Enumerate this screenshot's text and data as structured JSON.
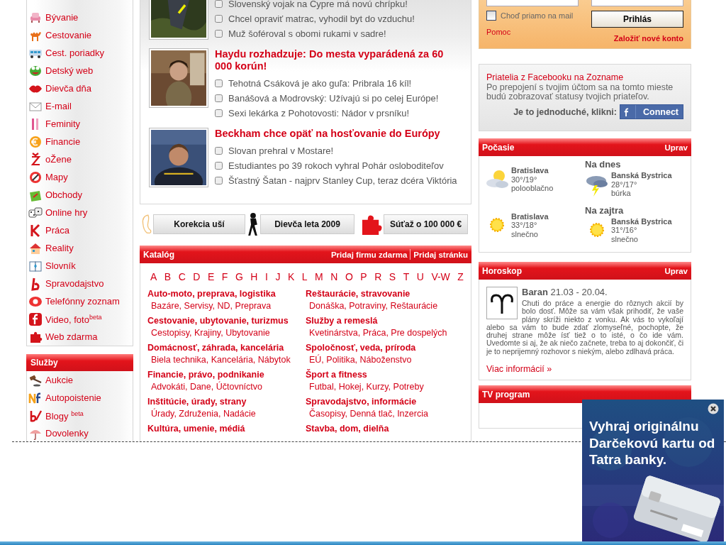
{
  "sidebar": {
    "items": [
      {
        "label": "Bývanie"
      },
      {
        "label": "Cestovanie"
      },
      {
        "label": "Cest. poriadky"
      },
      {
        "label": "Detský web"
      },
      {
        "label": "Dievča dňa"
      },
      {
        "label": "E-mail"
      },
      {
        "label": "Feminity"
      },
      {
        "label": "Financie"
      },
      {
        "label": "oŽene"
      },
      {
        "label": "Mapy"
      },
      {
        "label": "Obchody"
      },
      {
        "label": "Online hry"
      },
      {
        "label": "Práca"
      },
      {
        "label": "Reality"
      },
      {
        "label": "Slovník"
      },
      {
        "label": "Spravodajstvo"
      },
      {
        "label": "Telefónny zoznam"
      },
      {
        "label": "Video, foto$^{beta}$"
      },
      {
        "label": "Web zdarma"
      }
    ],
    "services": {
      "title": "Služby",
      "items": [
        {
          "label": "Aukcie"
        },
        {
          "label": "Autopoistenie"
        },
        {
          "label": "Blogy $^{beta}$"
        },
        {
          "label": "Dovolenky"
        }
      ]
    }
  },
  "news": [
    {
      "bullets": [
        "Slovenský vojak na Cypre má novú chrípku!",
        "Chcel opraviť matrac, vyhodil byt do vzduchu!",
        "Muž šoféroval s obomi rukami v sadre!"
      ]
    },
    {
      "headline": "Haydu rozhadzuje: Do mesta vyparádená za 60 000 korún!",
      "bullets": [
        "Tehotná Csáková je ako guľa: Pribrala 16 kíl!",
        "Banášová a Modrovský: Užívajú si po celej Európe!",
        "Sexi lekárka z Pohotovosti: Nádor v prsníku!"
      ]
    },
    {
      "headline": "Beckham chce opäť na hosťovanie do Európy",
      "bullets": [
        "Slovan prehral v Mostare!",
        "Estudiantes po 39 rokoch vyhral Pohár osloboditeľov",
        "Šťastný Šatan - najprv Stanley Cup, teraz dcéra Viktória"
      ]
    }
  ],
  "promos": [
    {
      "label": "Korekcia uší",
      "kind": "ear"
    },
    {
      "label": "Dievča leta 2009",
      "kind": "figure"
    },
    {
      "label": "Súťaž o 100 000 €",
      "kind": "puzzle"
    }
  ],
  "catalog": {
    "title": "Katalóg",
    "links": [
      "Pridaj firmu zdarma",
      "Pridaj stránku"
    ],
    "letters": [
      "A",
      "B",
      "C",
      "D",
      "E",
      "F",
      "G",
      "H",
      "I",
      "J",
      "K",
      "L",
      "M",
      "N",
      "O",
      "P",
      "R",
      "S",
      "T",
      "U",
      "V-W",
      "Z"
    ],
    "categories": [
      {
        "title": "Auto-moto, preprava, logistika",
        "sub": "Bazáre, Servisy, ND, Preprava"
      },
      {
        "title": "Reštaurácie, stravovanie",
        "sub": "Donáška, Potraviny, Reštaurácie"
      },
      {
        "title": "Cestovanie, ubytovanie, turizmus",
        "sub": "Cestopisy, Krajiny, Ubytovanie"
      },
      {
        "title": "Služby a remeslá",
        "sub": "Kvetinárstva, Práca, Pre dospelých"
      },
      {
        "title": "Domácnosť, záhrada, kancelária",
        "sub": "Biela technika, Kancelária, Nábytok"
      },
      {
        "title": "Spoločnosť, veda, príroda",
        "sub": "EÚ, Politika, Náboženstvo"
      },
      {
        "title": "Financie, právo, podnikanie",
        "sub": "Advokáti, Dane, Účtovníctvo"
      },
      {
        "title": "Šport a fitness",
        "sub": "Futbal, Hokej, Kurzy, Potreby"
      },
      {
        "title": "Inštitúcie, úrady, strany",
        "sub": "Úrady, Združenia, Nadácie"
      },
      {
        "title": "Spravodajstvo, informácie",
        "sub": "Časopisy, Denná tlač, Inzercia"
      },
      {
        "title": "Kultúra, umenie, médiá"
      },
      {
        "title": "Stavba, dom, dielňa"
      }
    ]
  },
  "login": {
    "remember": {
      "label": "Choď priamo na mail",
      "checked": false
    },
    "button": "Prihlás",
    "help": "Pomoc",
    "register": "Založiť nové konto"
  },
  "facebook": {
    "title": "Priatelia z Facebooku na Zozname",
    "text": "Po prepojení s tvojim účtom sa na tomto mieste budú zobrazovať statusy tvojich priateľov.",
    "prompt": "Je to jednoduché, klikni:",
    "button": "Connect"
  },
  "weather": {
    "title": "Počasie",
    "edit": "Uprav",
    "days": [
      {
        "heading": "Na dnes",
        "forecasts": [
          {
            "city": "Bratislava",
            "temp": "30°/19°",
            "condition": "polooblačno",
            "kind": "partly_cloudy"
          },
          {
            "city": "Banská Bystrica",
            "temp": "28°/17°",
            "condition": "búrka",
            "kind": "storm"
          }
        ]
      },
      {
        "heading": "Na zajtra",
        "forecasts": [
          {
            "city": "Bratislava",
            "temp": "33°/18°",
            "condition": "slnečno",
            "kind": "sunny"
          },
          {
            "city": "Banská Bystrica",
            "temp": "31°/16°",
            "condition": "slnečno",
            "kind": "sunny"
          }
        ]
      }
    ]
  },
  "horoscope": {
    "title": "Horoskop",
    "edit": "Uprav",
    "sign": "Baran",
    "dates": "21.03 - 20.04.",
    "text": [
      "Chuti do práce a energie do rôznych akcií by bolo dosť. Môže sa vám však prihodiť, že vaše plány skríži niekto z vonku. Ak vás to vykoľají",
      "alebo sa vám to bude zdať zlomyseľné, pochopte, že druhej strane môže ísť tiež o to isté, o čo ide vám. Uvedomte si aj, že ak niečo začnete, treba to aj dokončiť, či je to neprijemný rozhovor s niekým, alebo zdlhavá práca."
    ],
    "more": "Viac informácií »"
  },
  "tv": {
    "title": "TV program"
  },
  "ad": {
    "text": "Vyhraj originálnu Darčekovú kartu od Tatra banky."
  }
}
